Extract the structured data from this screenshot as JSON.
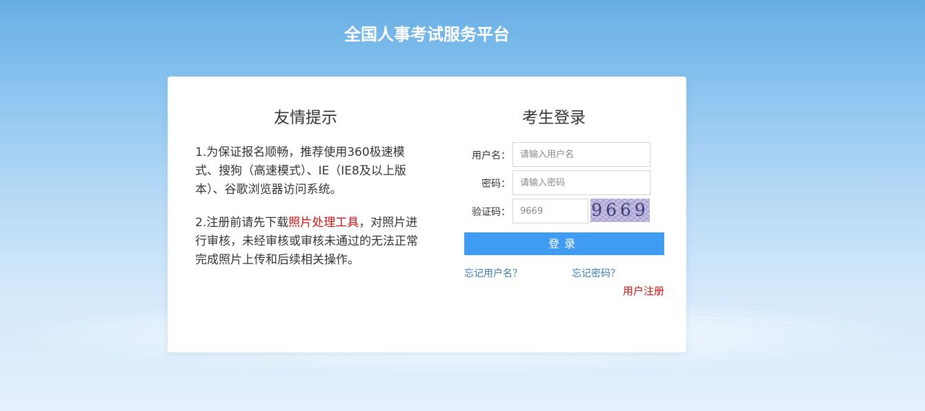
{
  "header": {
    "title": "全国人事考试服务平台"
  },
  "tips": {
    "title": "友情提示",
    "item1": "1.为保证报名顺畅，推荐使用360极速模式、搜狗（高速模式）、IE（IE8及以上版本）、谷歌浏览器访问系统。",
    "item2_before": "2.注册前请先下载",
    "item2_link": "照片处理工具",
    "item2_after": "，对照片进行审核，未经审核或审核未通过的无法正常完成照片上传和后续相关操作。"
  },
  "login": {
    "title": "考生登录",
    "username_label": "用户名：",
    "username_placeholder": "请输入用户名",
    "password_label": "密码：",
    "password_placeholder": "请输入密码",
    "captcha_label": "验证码：",
    "captcha_value": "9669",
    "captcha_image_text": "9669",
    "submit_label": "登录",
    "forgot_username": "忘记用户名？",
    "forgot_password": "忘记密码？",
    "register": "用户注册"
  },
  "colors": {
    "accent": "#3f9cf2",
    "highlight_red": "#cc1111",
    "link": "#3a7ab3"
  }
}
